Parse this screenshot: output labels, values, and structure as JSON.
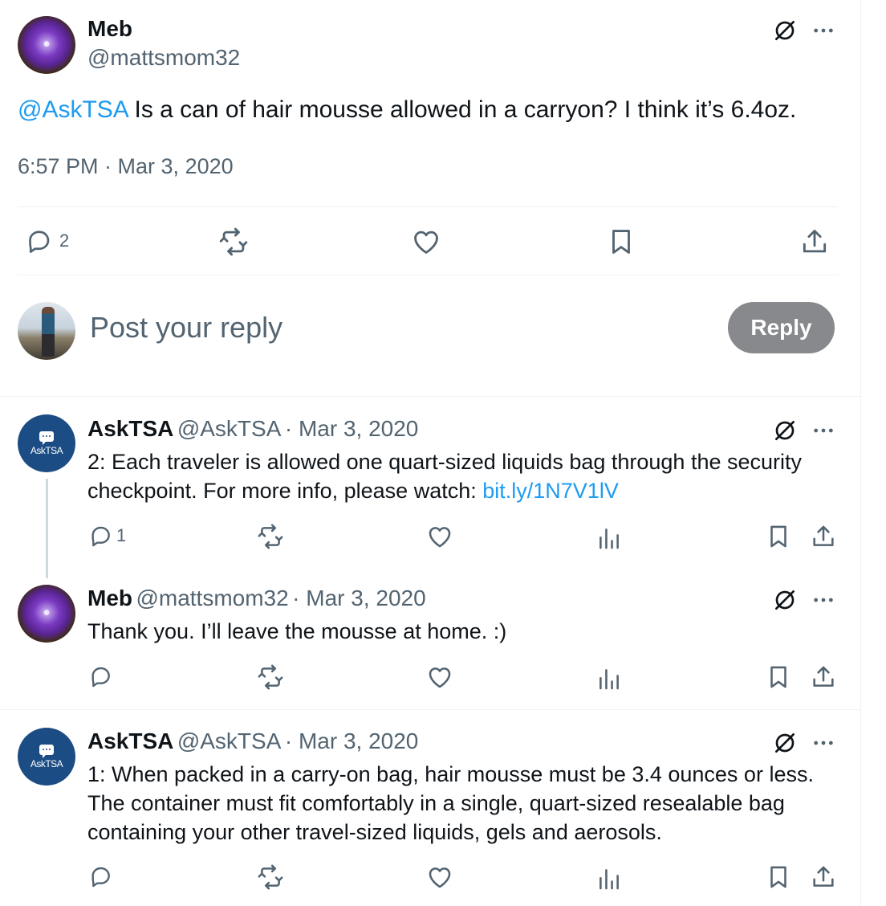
{
  "main_tweet": {
    "name": "Meb",
    "handle": "@mattsmom32",
    "mention": "@AskTSA",
    "text": " Is a can of hair mousse allowed in a carryon? I think it’s 6.4oz.",
    "timestamp": "6:57 PM · Mar 3, 2020",
    "reply_count": "2"
  },
  "composer": {
    "placeholder": "Post your reply",
    "button_label": "Reply"
  },
  "replies": [
    {
      "name": "AskTSA",
      "handle": "@AskTSA",
      "date": "· Mar 3, 2020",
      "avatar_text": "AskTSA",
      "text": "2: Each traveler is allowed one quart-sized liquids bag through the security checkpoint. For more info, please watch: ",
      "link": "bit.ly/1N7V1lV",
      "reply_count": "1"
    },
    {
      "name": "Meb",
      "handle": "@mattsmom32",
      "date": "· Mar 3, 2020",
      "text": "Thank you. I’ll leave the mousse at home. :)",
      "reply_count": ""
    },
    {
      "name": "AskTSA",
      "handle": "@AskTSA",
      "date": "· Mar 3, 2020",
      "avatar_text": "AskTSA",
      "text": "1: When packed in a carry-on bag, hair mousse must be 3.4 ounces or less. The container must fit comfortably in a single, quart-sized resealable bag containing your other travel-sized liquids, gels and aerosols.",
      "reply_count": ""
    }
  ],
  "icons": {
    "reply": "reply-icon",
    "repost": "repost-icon",
    "like": "like-icon",
    "bookmark": "bookmark-icon",
    "share": "share-icon",
    "views": "views-icon",
    "grok": "grok-icon",
    "more": "more-icon"
  },
  "colors": {
    "link": "#1d9bf0",
    "text": "#0f1419",
    "secondary": "#536471",
    "reply_button": "#87898c",
    "tsa_avatar": "#1b4c84"
  }
}
